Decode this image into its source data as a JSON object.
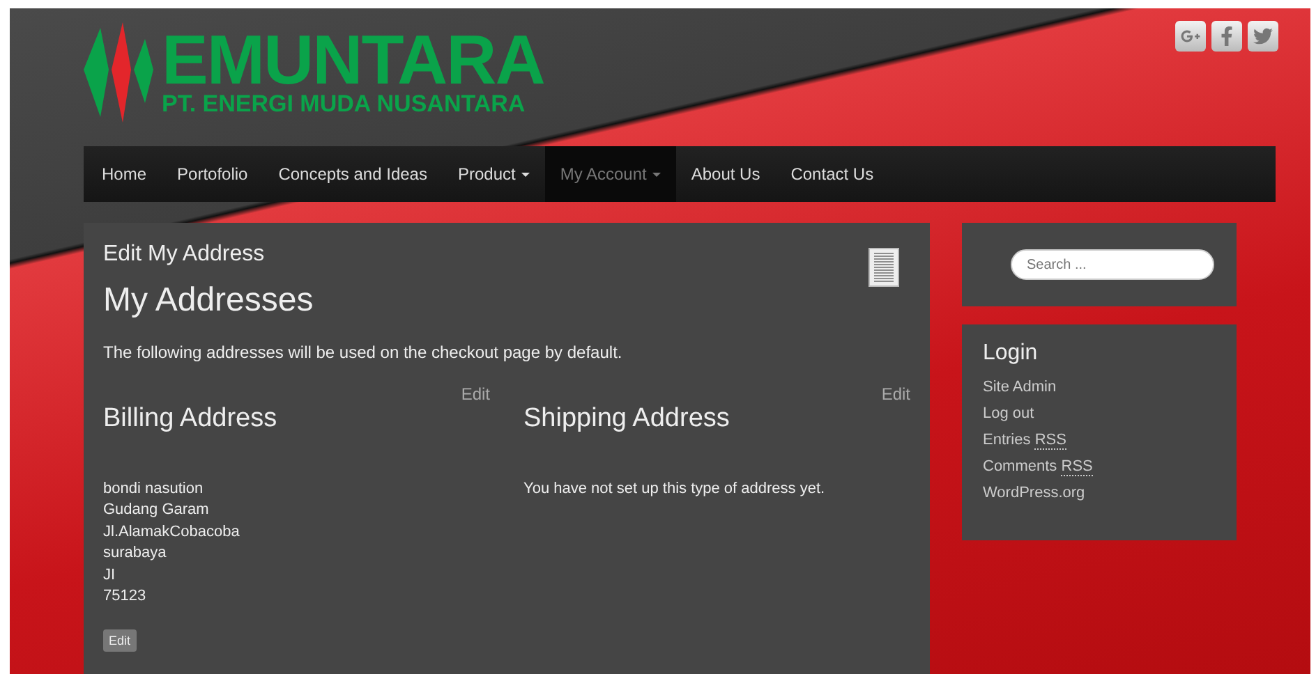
{
  "logo": {
    "name": "EMUNTARA",
    "tagline": "PT. ENERGI MUDA NUSANTARA"
  },
  "nav": [
    {
      "label": "Home",
      "selected": false,
      "dropdown": false
    },
    {
      "label": "Portofolio",
      "selected": false,
      "dropdown": false
    },
    {
      "label": "Concepts and Ideas",
      "selected": false,
      "dropdown": false
    },
    {
      "label": "Product",
      "selected": false,
      "dropdown": true
    },
    {
      "label": "My Account",
      "selected": true,
      "dropdown": true
    },
    {
      "label": "About Us",
      "selected": false,
      "dropdown": false
    },
    {
      "label": "Contact Us",
      "selected": false,
      "dropdown": false
    }
  ],
  "main": {
    "page_title": "Edit My Address",
    "heading": "My Addresses",
    "intro": "The following addresses will be used on the checkout page by default.",
    "addresses": [
      {
        "title": "Billing Address",
        "edit": "Edit",
        "lines": [
          "bondi nasution",
          "Gudang Garam",
          "Jl.AlamakCobacoba",
          "surabaya",
          "JI",
          "75123"
        ]
      },
      {
        "title": "Shipping Address",
        "edit": "Edit",
        "lines": [
          "You have not set up this type of address yet."
        ]
      }
    ],
    "edit_button": "Edit"
  },
  "sidebar": {
    "search": {
      "placeholder": "Search ..."
    },
    "login": {
      "title": "Login",
      "links": [
        {
          "label": "Site Admin"
        },
        {
          "label": "Log out"
        },
        {
          "label": "Entries",
          "abbr": "RSS"
        },
        {
          "label": "Comments",
          "abbr": "RSS"
        },
        {
          "label": "WordPress.org"
        }
      ]
    }
  }
}
